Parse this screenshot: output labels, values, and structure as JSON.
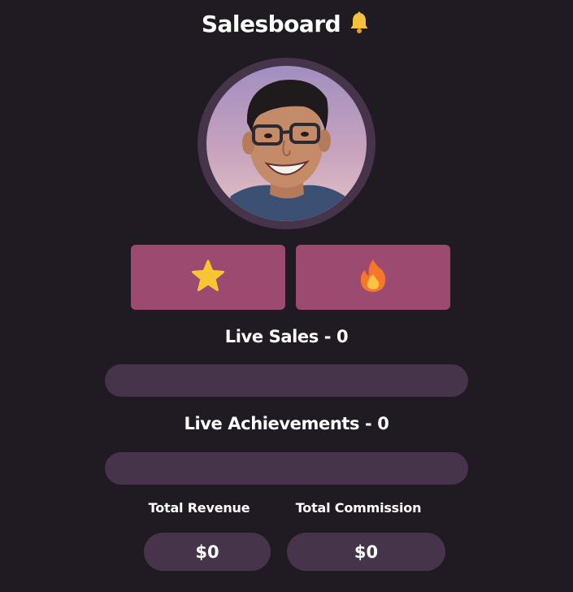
{
  "header": {
    "title": "Salesboard",
    "title_icon": "bell-icon"
  },
  "profile": {
    "avatar": "profile-photo"
  },
  "reaction_tiles": [
    {
      "icon": "star-icon",
      "color": "#9d4a70"
    },
    {
      "icon": "fire-icon",
      "color": "#9d4a70"
    }
  ],
  "live_sales": {
    "label": "Live Sales - 0"
  },
  "live_achievements": {
    "label": "Live Achievements - 0"
  },
  "totals": {
    "revenue_label": "Total Revenue",
    "revenue_value": "$0",
    "commission_label": "Total Commission",
    "commission_value": "$0"
  },
  "colors": {
    "background": "#201b22",
    "tile": "#9d4a70",
    "bar": "#45344a",
    "text": "#ffffff"
  }
}
